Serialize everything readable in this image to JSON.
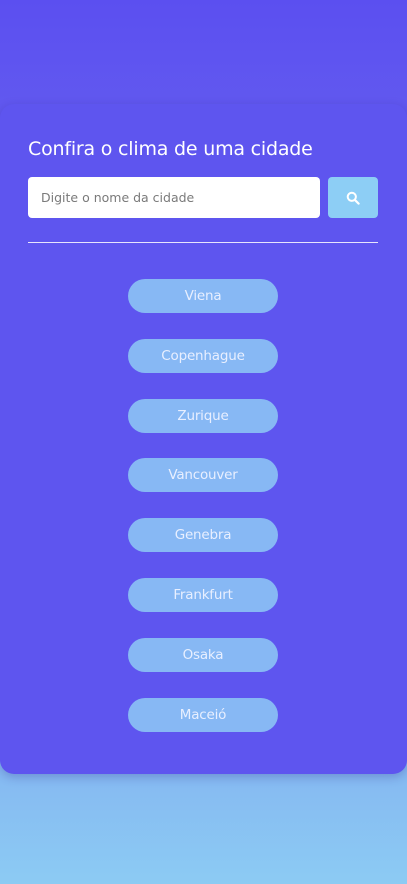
{
  "page": {
    "title": "Confira o clima de uma cidade"
  },
  "search": {
    "placeholder": "Digite o nome da cidade",
    "value": "",
    "button_icon": "search-icon"
  },
  "cities": [
    {
      "label": "Viena"
    },
    {
      "label": "Copenhague"
    },
    {
      "label": "Zurique"
    },
    {
      "label": "Vancouver"
    },
    {
      "label": "Genebra"
    },
    {
      "label": "Frankfurt"
    },
    {
      "label": "Osaka"
    },
    {
      "label": "Maceió"
    }
  ],
  "colors": {
    "background_top": "#5b4ff0",
    "background_bottom": "#8ccbf3",
    "card": "#5e55ef",
    "search_button": "#8dcef5",
    "city_button": "#87b8f4",
    "text_light": "#ffffff"
  }
}
